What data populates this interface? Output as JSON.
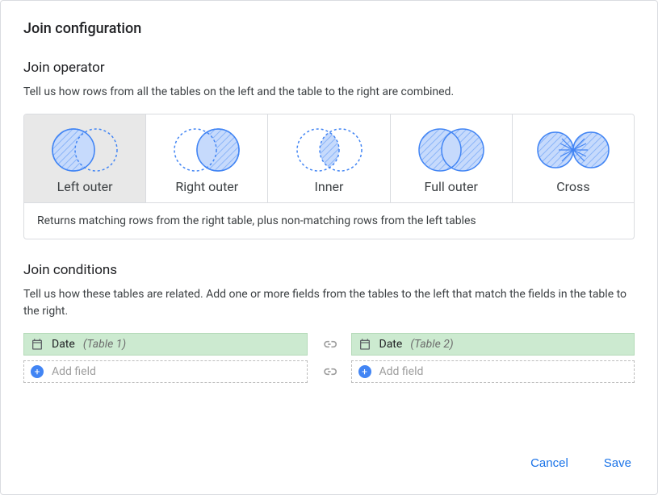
{
  "title": "Join configuration",
  "operator_section": {
    "title": "Join operator",
    "description": "Tell us how rows from all the tables on the left and the table to the right are combined.",
    "options": [
      {
        "label": "Left outer",
        "selected": true
      },
      {
        "label": "Right outer",
        "selected": false
      },
      {
        "label": "Inner",
        "selected": false
      },
      {
        "label": "Full outer",
        "selected": false
      },
      {
        "label": "Cross",
        "selected": false
      }
    ],
    "selected_description": "Returns matching rows from the right table, plus non-matching rows from the left tables"
  },
  "conditions_section": {
    "title": "Join conditions",
    "description": "Tell us how these tables are related. Add one or more fields from the tables to the left that match the fields in the table to the right.",
    "rows": [
      {
        "left": {
          "field": "Date",
          "source": "(Table 1)",
          "icon": "calendar"
        },
        "right": {
          "field": "Date",
          "source": "(Table 2)",
          "icon": "calendar"
        }
      }
    ],
    "add_label": "Add field"
  },
  "actions": {
    "cancel": "Cancel",
    "save": "Save"
  }
}
